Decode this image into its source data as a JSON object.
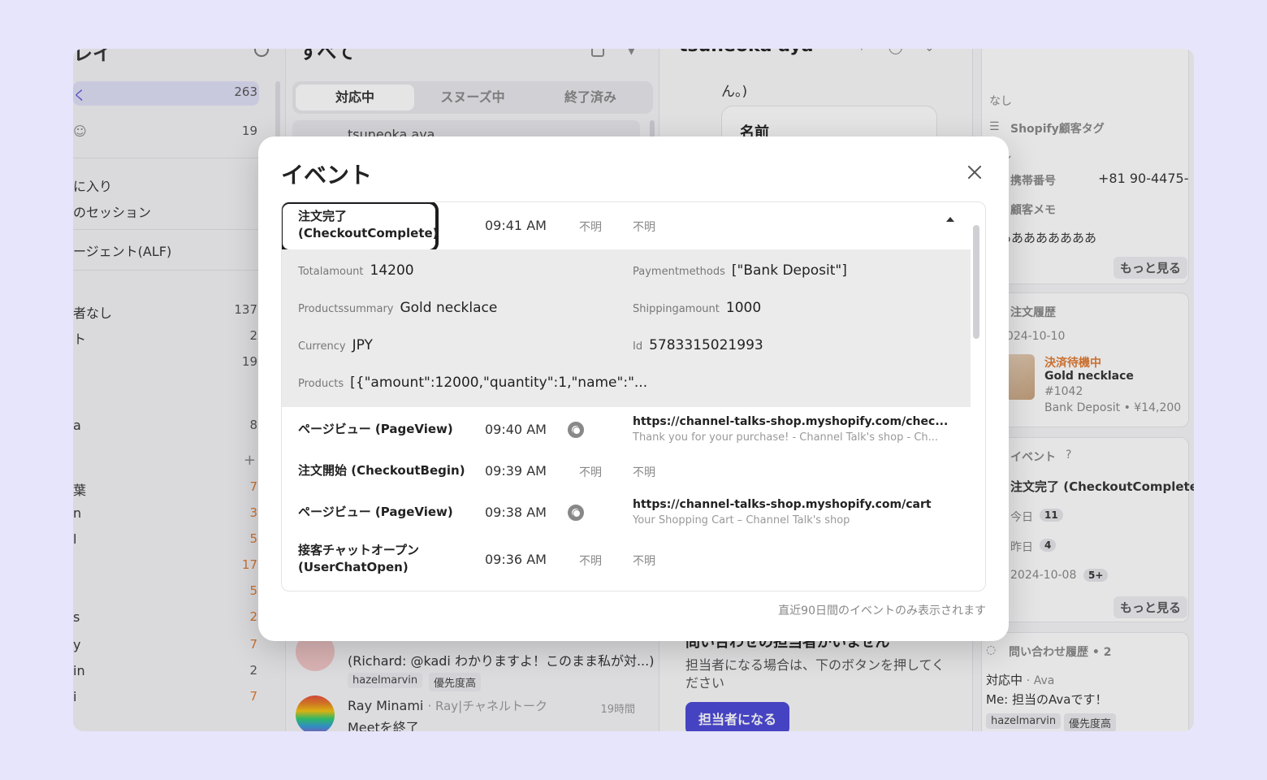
{
  "left": {
    "title": "レイ",
    "items": [
      {
        "label": "く",
        "count": "263"
      },
      {
        "label": "☺",
        "count": "19"
      },
      {
        "label": "に入り",
        "count": ""
      },
      {
        "label": "のセッション",
        "count": ""
      },
      {
        "label": "ージェント(ALF)",
        "count": ""
      },
      {
        "label": "者なし",
        "count": "137"
      },
      {
        "label": "ト",
        "count": "2"
      },
      {
        "label": "",
        "count": "19"
      },
      {
        "label": "a",
        "count": "8"
      },
      {
        "label": "葉",
        "count": "7"
      },
      {
        "label": "n",
        "count": "3"
      },
      {
        "label": "l",
        "count": "5"
      },
      {
        "label": "",
        "count": "17"
      },
      {
        "label": "",
        "count": "5"
      },
      {
        "label": "s",
        "count": "2"
      },
      {
        "label": "y",
        "count": "7"
      },
      {
        "label": "in",
        "count": "2"
      },
      {
        "label": "i",
        "count": "7"
      }
    ]
  },
  "middle": {
    "title": "すべて",
    "tabs": [
      "対応中",
      "スヌーズ中",
      "終了済み"
    ],
    "top_conv": {
      "name": "tsuneoka aya"
    },
    "conv1": {
      "message": "(Richard: @kadi わかりますよ！このまま私が対...)",
      "tags": [
        "hazelmarvin",
        "優先度高"
      ]
    },
    "conv2": {
      "name": "Ray Minami",
      "sub": "· Ray|チャネルトーク",
      "time": "19時間",
      "message": "Meetを終了"
    }
  },
  "chat": {
    "title": "tsuneoka aya",
    "snippet": "ん。)",
    "form_label": "名前",
    "no_assignee_title": "問い合わせの担当者がいません",
    "no_assignee_desc": "担当者になる場合は、下のボタンを押してください",
    "assign_button": "担当者になる"
  },
  "info": {
    "none1": "なし",
    "shopify_tag_label": "Shopify顧客タグ",
    "none2": "なし",
    "phone_label": "携帯番号",
    "phone_value": "+81 90-4475-",
    "memo_label": "顧客メモ",
    "memo_value": "ああああああああ",
    "more": "もっと見る",
    "order_history": "注文履歴",
    "order_date": "2024-10-10",
    "order_status": "決済待機中",
    "order_product": "Gold necklace",
    "order_no": "#1042",
    "order_payment": "Bank Deposit • ¥14,200",
    "event_label": "イベント",
    "event_latest": "注文完了 (CheckoutComplete)",
    "today": "今日",
    "today_count": "11",
    "yesterday": "昨日",
    "yesterday_count": "4",
    "date3": "2024-10-08",
    "date3_count": "5+",
    "inquiry_history": "問い合わせ履歴 • 2",
    "inquiry_status": "対応中",
    "inquiry_assignee": "· Ava",
    "inquiry_msg": "Me: 担当のAvaです！",
    "inquiry_tags": [
      "hazelmarvin",
      "優先度高"
    ]
  },
  "modal": {
    "title": "イベント",
    "footnote": "直近90日間のイベントのみ表示されます",
    "expanded": {
      "name_line1": "注文完了",
      "name_line2": "(CheckoutComplete)",
      "time": "09:41 AM",
      "device": "不明",
      "location": "不明",
      "props": {
        "totalamount_k": "Totalamount",
        "totalamount_v": "14200",
        "paymentmethods_k": "Paymentmethods",
        "paymentmethods_v": "[\"Bank Deposit\"]",
        "productssummary_k": "Productssummary",
        "productssummary_v": "Gold necklace",
        "shippingamount_k": "Shippingamount",
        "shippingamount_v": "1000",
        "currency_k": "Currency",
        "currency_v": "JPY",
        "id_k": "Id",
        "id_v": "5783315021993",
        "products_k": "Products",
        "products_v": "[{\"amount\":12000,\"quantity\":1,\"name\":\"..."
      }
    },
    "rows": [
      {
        "name": "ページビュー (PageView)",
        "time": "09:40 AM",
        "url": "https://channel-talks-shop.myshopify.com/chec...",
        "page_title": "Thank you for your purchase! - Channel Talk's shop - Ch..."
      },
      {
        "name": "注文開始 (CheckoutBegin)",
        "time": "09:39 AM",
        "device": "不明",
        "location": "不明"
      },
      {
        "name": "ページビュー (PageView)",
        "time": "09:38 AM",
        "url": "https://channel-talks-shop.myshopify.com/cart",
        "page_title": "Your Shopping Cart – Channel Talk's shop"
      },
      {
        "name_line1": "接客チャットオープン",
        "name_line2": "(UserChatOpen)",
        "time": "09:36 AM",
        "device": "不明",
        "location": "不明"
      }
    ]
  }
}
